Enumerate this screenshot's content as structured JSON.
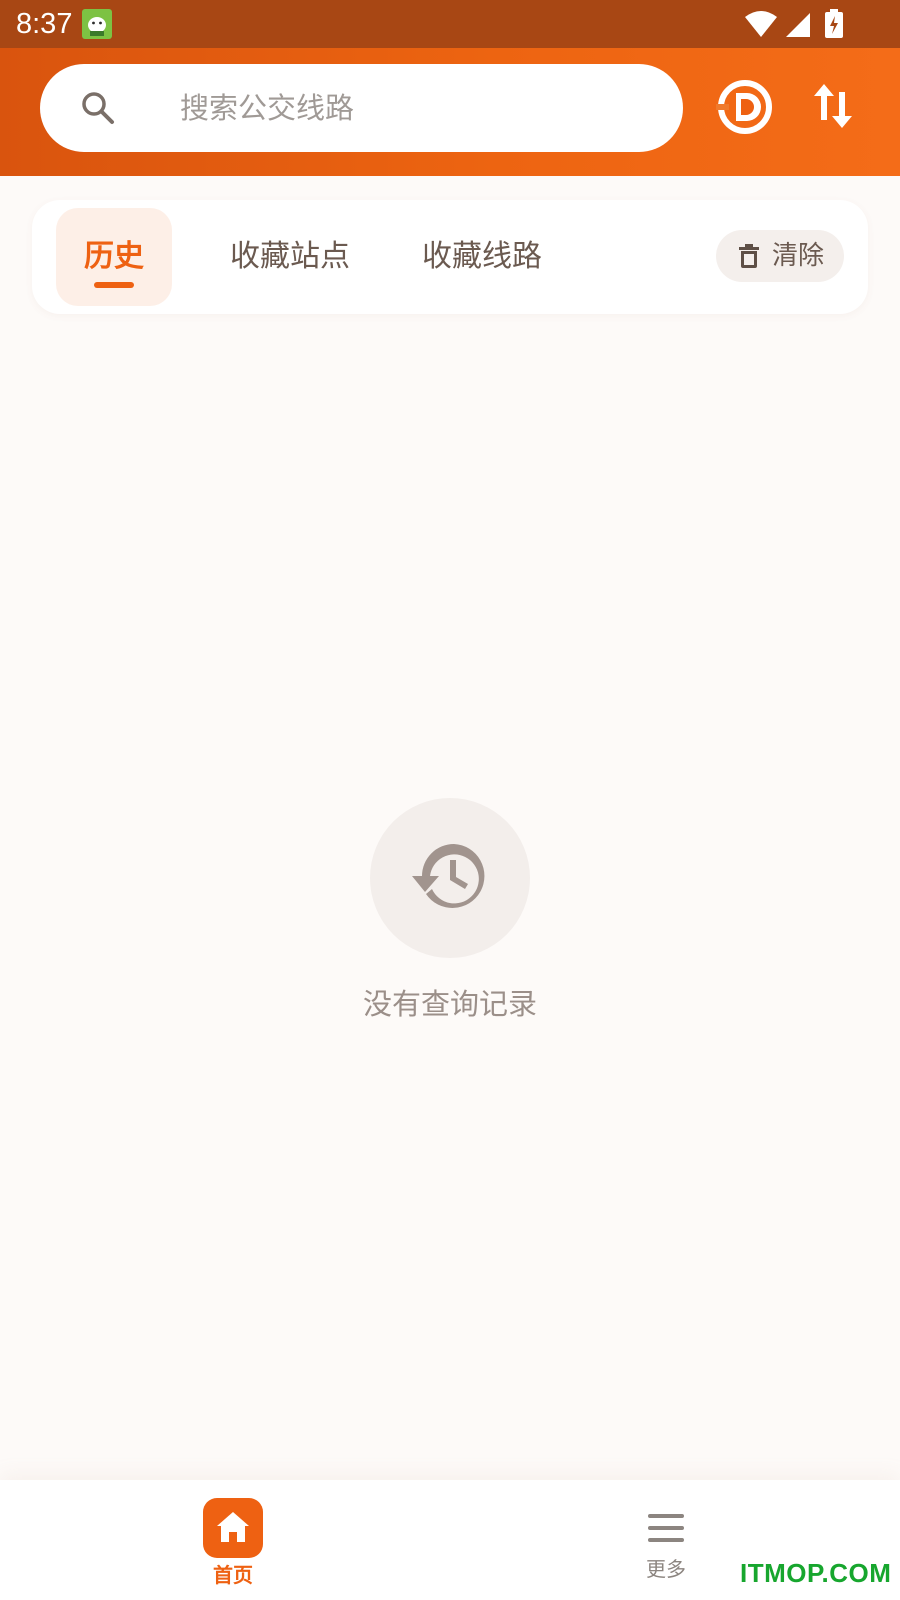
{
  "status_bar": {
    "time": "8:37"
  },
  "header": {
    "search": {
      "placeholder": "搜索公交线路"
    },
    "icons": [
      "search-icon",
      "metro-logo-icon",
      "swap-icon"
    ]
  },
  "tabs": {
    "items": [
      {
        "label": "历史",
        "active": true
      },
      {
        "label": "收藏站点",
        "active": false
      },
      {
        "label": "收藏线路",
        "active": false
      }
    ],
    "clear_label": "清除"
  },
  "empty_state": {
    "icon": "history-icon",
    "message": "没有查询记录"
  },
  "bottom_nav": {
    "items": [
      {
        "label": "首页",
        "icon": "home-icon",
        "active": true
      },
      {
        "label": "更多",
        "icon": "menu-icon",
        "active": false
      }
    ]
  },
  "watermark": "ITMOP.COM",
  "colors": {
    "accent": "#ee6112",
    "status_bar": "#a84714",
    "background": "#fdfaf8",
    "watermark": "#17a62e"
  }
}
